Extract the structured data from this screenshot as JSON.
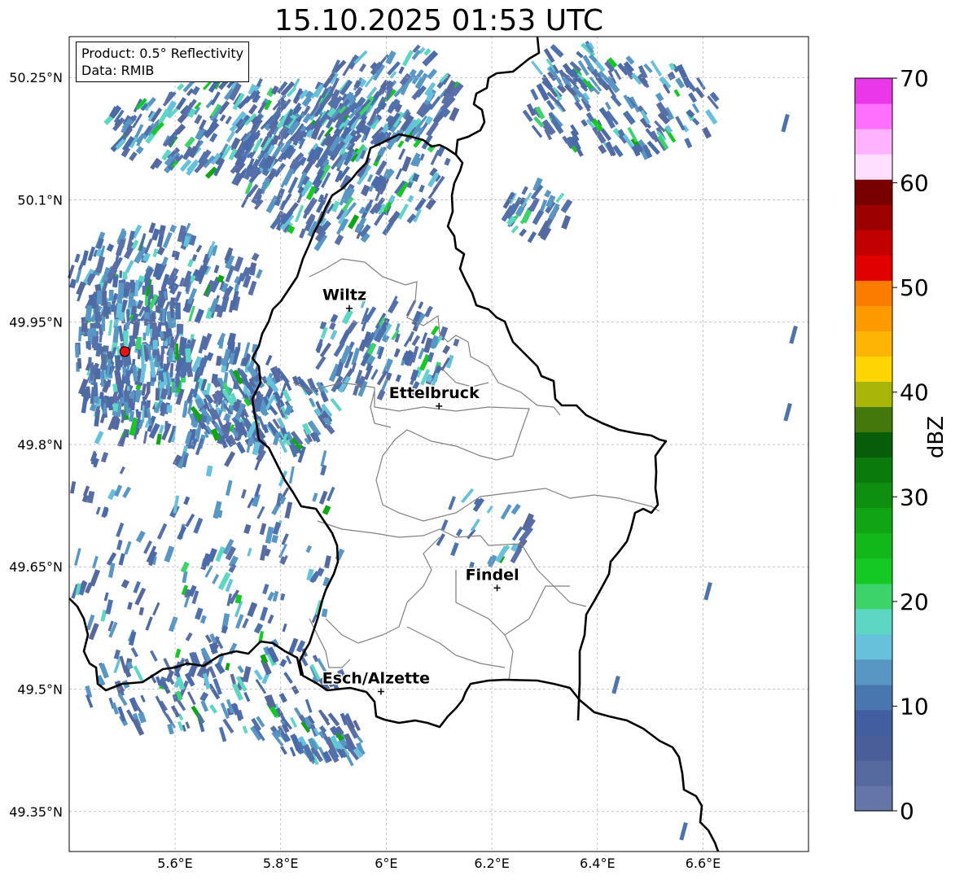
{
  "title": "15.10.2025 01:53 UTC",
  "info_box": {
    "line1": "Product: 0.5° Reflectivity",
    "line2": "Data: RMIB"
  },
  "map": {
    "lon_range": [
      5.4,
      6.8
    ],
    "lat_range": [
      49.3,
      50.3
    ],
    "lon_ticks": [
      {
        "value": 5.6,
        "label": "5.6°E"
      },
      {
        "value": 5.8,
        "label": "5.8°E"
      },
      {
        "value": 6.0,
        "label": "6°E"
      },
      {
        "value": 6.2,
        "label": "6.2°E"
      },
      {
        "value": 6.4,
        "label": "6.4°E"
      },
      {
        "value": 6.6,
        "label": "6.6°E"
      }
    ],
    "lat_ticks": [
      {
        "value": 50.25,
        "label": "50.25°N"
      },
      {
        "value": 50.1,
        "label": "50.1°N"
      },
      {
        "value": 49.95,
        "label": "49.95°N"
      },
      {
        "value": 49.8,
        "label": "49.8°N"
      },
      {
        "value": 49.65,
        "label": "49.65°N"
      },
      {
        "value": 49.5,
        "label": "49.5°N"
      },
      {
        "value": 49.35,
        "label": "49.35°N"
      }
    ],
    "cities": [
      {
        "name": "Wiltz",
        "lon": 5.93,
        "lat": 49.967
      },
      {
        "name": "Ettelbruck",
        "lon": 6.1,
        "lat": 49.847
      },
      {
        "name": "Findel",
        "lon": 6.21,
        "lat": 49.624
      },
      {
        "name": "Esch/Alzette",
        "lon": 5.99,
        "lat": 49.497
      }
    ],
    "radar_site": {
      "lon": 5.505,
      "lat": 49.914
    },
    "colors": {
      "border": "#000000",
      "district": "#808080",
      "grid": "#b0b0b0",
      "radar_site": "#e8101a"
    }
  },
  "colorbar": {
    "label": "dBZ",
    "min": 0,
    "max": 70,
    "ticks": [
      {
        "value": 0,
        "label": "0"
      },
      {
        "value": 10,
        "label": "10"
      },
      {
        "value": 20,
        "label": "20"
      },
      {
        "value": 30,
        "label": "30"
      },
      {
        "value": 40,
        "label": "40"
      },
      {
        "value": 50,
        "label": "50"
      },
      {
        "value": 60,
        "label": "60"
      },
      {
        "value": 70,
        "label": "70"
      }
    ],
    "colors": [
      "#6575a6",
      "#56699e",
      "#4a5f9a",
      "#435e9f",
      "#4a76b0",
      "#5896c4",
      "#67c1db",
      "#5ed6c4",
      "#3cd46a",
      "#14c922",
      "#12b81a",
      "#10a514",
      "#0f8f10",
      "#0b7a0c",
      "#075d08",
      "#45780c",
      "#aab50a",
      "#ffd500",
      "#fdb405",
      "#fc9a00",
      "#fc7c00",
      "#e10000",
      "#c30000",
      "#9c0000",
      "#790000",
      "#ffdfff",
      "#ffb3ff",
      "#ff70ff",
      "#ea37ea"
    ]
  }
}
